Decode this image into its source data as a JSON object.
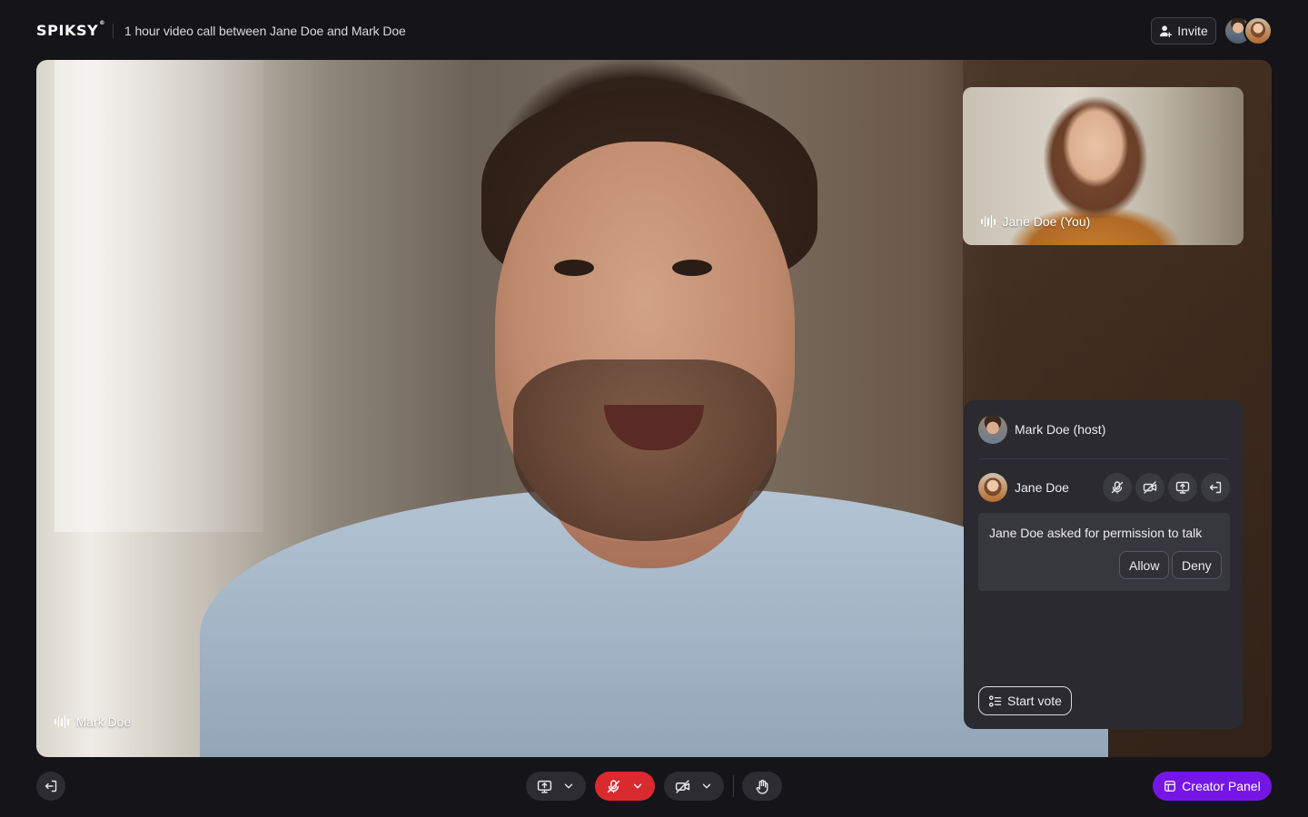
{
  "header": {
    "logo": "SPIKSY",
    "logo_mark": "®",
    "call_title": "1 hour video call between Jane Doe and Mark Doe",
    "invite_label": "Invite",
    "invite_icon": "add-user-icon"
  },
  "main_video": {
    "participant_name": "Mark Doe",
    "audio_icon": "audio-wave-icon"
  },
  "self_view": {
    "participant_name": "Jane Doe (You)",
    "audio_icon": "audio-wave-icon"
  },
  "panel": {
    "host": {
      "name": "Mark Doe (host)"
    },
    "guest": {
      "name": "Jane Doe",
      "actions": [
        "mute-mic-icon",
        "camera-off-icon",
        "screen-share-icon",
        "remove-icon"
      ]
    },
    "request": {
      "text": "Jane Doe asked for permission to talk",
      "allow_label": "Allow",
      "deny_label": "Deny"
    },
    "start_vote_label": "Start vote"
  },
  "toolbar": {
    "leave_icon": "leave-icon",
    "share_icon": "screen-share-icon",
    "mic_icon": "mic-muted-icon",
    "mic_state": "muted",
    "camera_icon": "camera-off-icon",
    "hand_icon": "raise-hand-icon",
    "creator_panel_label": "Creator Panel"
  },
  "colors": {
    "background": "#151519",
    "panel": "#2a2a30",
    "mic_muted": "#d92b2f",
    "creator_accent": "#7616e6"
  }
}
